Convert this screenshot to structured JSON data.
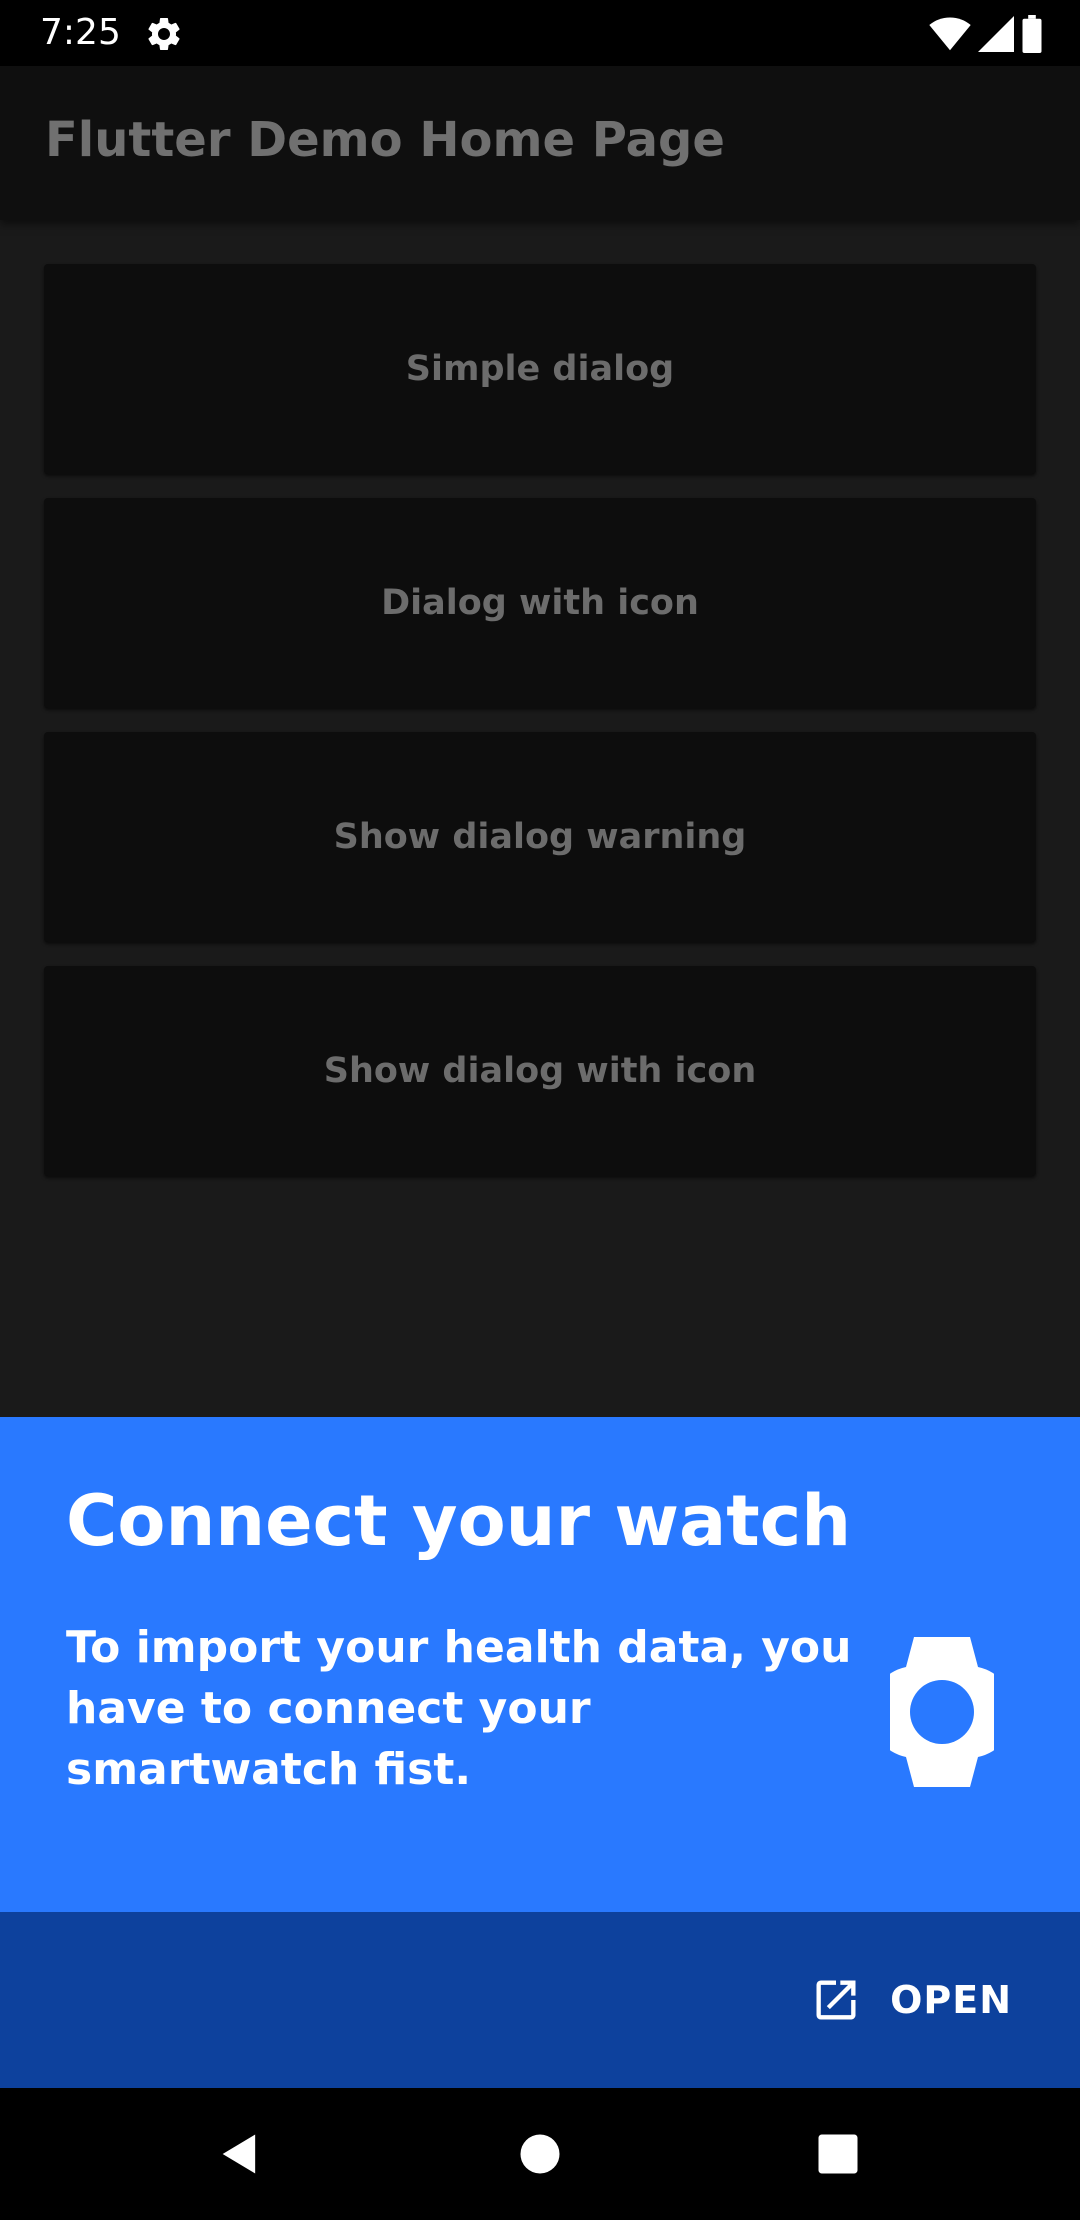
{
  "status_bar": {
    "time": "7:25",
    "icons": [
      "settings-icon",
      "wifi-icon",
      "signal-icon",
      "battery-icon"
    ]
  },
  "app_bar": {
    "title": "Flutter Demo Home Page"
  },
  "buttons": [
    {
      "label": "Simple dialog"
    },
    {
      "label": "Dialog with icon"
    },
    {
      "label": "Show dialog warning"
    },
    {
      "label": "Show dialog with icon"
    }
  ],
  "banner": {
    "title": "Connect your watch",
    "body": "To import your health data, you have to connect your smartwatch fist.",
    "icon": "watch-icon",
    "open_label": "OPEN",
    "open_icon": "open-in-new-icon"
  },
  "nav_bar": {
    "icons": [
      "back-icon",
      "home-icon",
      "recents-icon"
    ]
  },
  "colors": {
    "banner_bg": "#2979ff",
    "action_bar_bg": "#0d419d",
    "background": "#1a1a1a"
  }
}
